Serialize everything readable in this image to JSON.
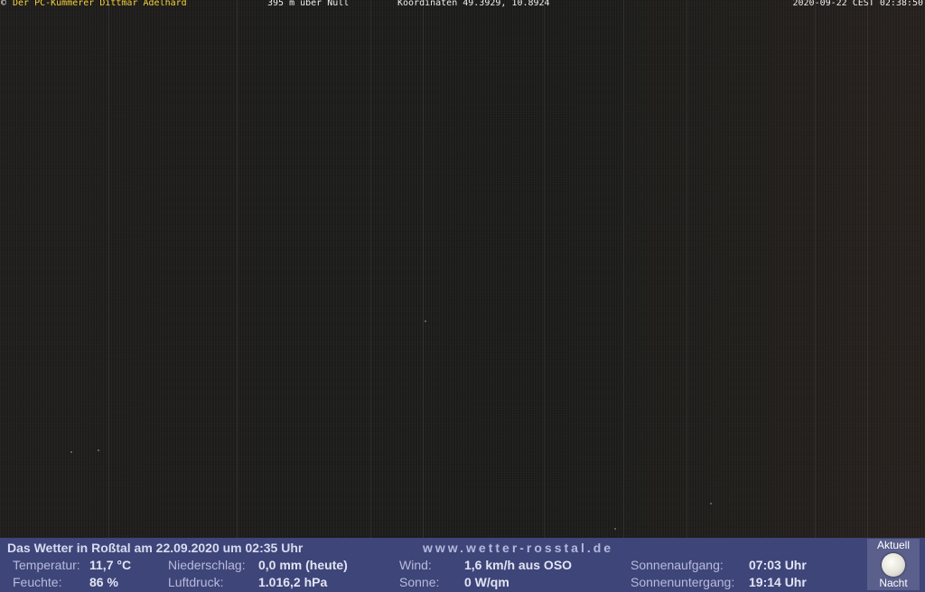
{
  "overlay": {
    "copyright_symbol": "©",
    "owner": "Der PC-Kümmerer Dittmar Adelhard",
    "altitude": "395 m über Null",
    "coordinates": "Koordinaten 49.3929, 10.8924",
    "datetime": "2020-09-22 CEST 02:38:50"
  },
  "weather": {
    "title": "Das Wetter in Roßtal am 22.09.2020 um 02:35 Uhr",
    "site": "www.wetter-rosstal.de",
    "temperature_label": "Temperatur:",
    "temperature_value": "11,7 °C",
    "humidity_label": "Feuchte:",
    "humidity_value": "86 %",
    "precip_label": "Niederschlag:",
    "precip_value": "0,0 mm (heute)",
    "pressure_label": "Luftdruck:",
    "pressure_value": "1.016,2 hPa",
    "wind_label": "Wind:",
    "wind_value": "1,6 km/h aus OSO",
    "sun_label": "Sonne:",
    "sun_value": "0 W/qm",
    "sunrise_label": "Sonnenaufgang:",
    "sunrise_value": "07:03 Uhr",
    "sunset_label": "Sonnenuntergang:",
    "sunset_value": "19:14 Uhr",
    "moon_top": "Aktuell",
    "moon_bottom": "Nacht",
    "moon_icon": "full-moon-icon"
  },
  "colors": {
    "weather_bar": "#3e4578",
    "overlay_name": "#f4d23a"
  }
}
